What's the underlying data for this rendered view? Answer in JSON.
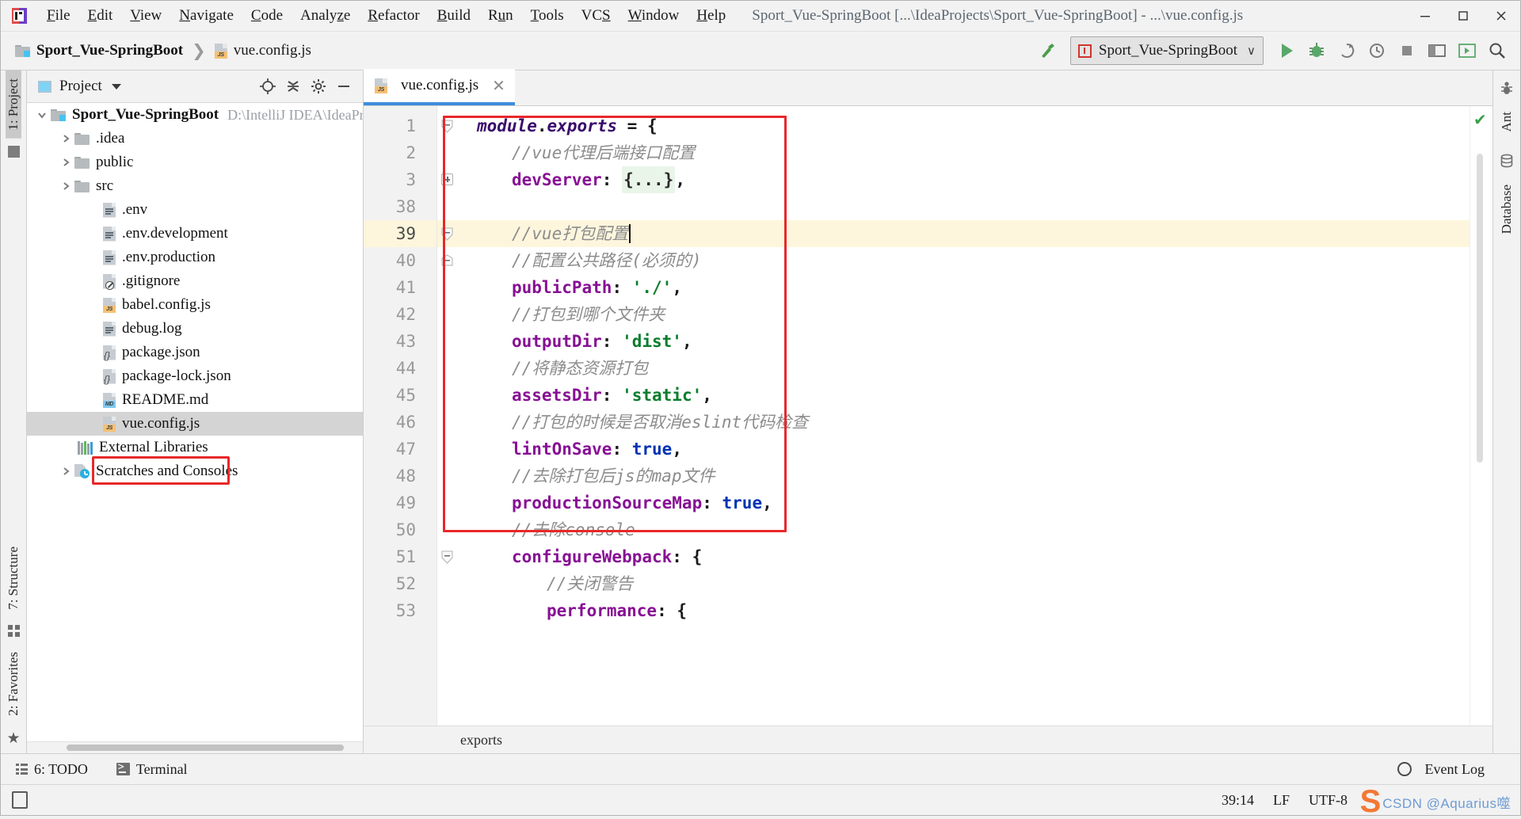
{
  "window": {
    "title": "Sport_Vue-SpringBoot [...\\IdeaProjects\\Sport_Vue-SpringBoot] - ...\\vue.config.js",
    "minimize": "—",
    "maximize": "□",
    "close": "✕"
  },
  "menubar": [
    {
      "label": "File",
      "mnemonic": "F"
    },
    {
      "label": "Edit",
      "mnemonic": "E"
    },
    {
      "label": "View",
      "mnemonic": "V"
    },
    {
      "label": "Navigate",
      "mnemonic": "N"
    },
    {
      "label": "Code",
      "mnemonic": "C"
    },
    {
      "label": "Analyze",
      "mnemonic": "z"
    },
    {
      "label": "Refactor",
      "mnemonic": "R"
    },
    {
      "label": "Build",
      "mnemonic": "B"
    },
    {
      "label": "Run",
      "mnemonic": "u"
    },
    {
      "label": "Tools",
      "mnemonic": "T"
    },
    {
      "label": "VCS",
      "mnemonic": "S"
    },
    {
      "label": "Window",
      "mnemonic": "W"
    },
    {
      "label": "Help",
      "mnemonic": "H"
    }
  ],
  "toolbar": {
    "breadcrumb_project": "Sport_Vue-SpringBoot",
    "breadcrumb_sep": "❯",
    "breadcrumb_file": "vue.config.js",
    "run_config": "Sport_Vue-SpringBoot",
    "run_config_chevron": "∨"
  },
  "project_panel": {
    "title": "Project",
    "tree": [
      {
        "label": "Sport_Vue-SpringBoot",
        "path": "D:\\IntelliJ IDEA\\IdeaProj",
        "icon": "folder-module-icon",
        "arrow": "down",
        "depth": 0,
        "bold": true
      },
      {
        "label": ".idea",
        "icon": "folder-icon",
        "arrow": "right",
        "depth": 1
      },
      {
        "label": "public",
        "icon": "folder-icon",
        "arrow": "right",
        "depth": 1
      },
      {
        "label": "src",
        "icon": "folder-icon",
        "arrow": "right",
        "depth": 1
      },
      {
        "label": ".env",
        "icon": "file-text-icon",
        "depth": 2
      },
      {
        "label": ".env.development",
        "icon": "file-text-icon",
        "depth": 2
      },
      {
        "label": ".env.production",
        "icon": "file-text-icon",
        "depth": 2
      },
      {
        "label": ".gitignore",
        "icon": "file-ignored-icon",
        "depth": 2
      },
      {
        "label": "babel.config.js",
        "icon": "file-js-icon",
        "depth": 2
      },
      {
        "label": "debug.log",
        "icon": "file-text-icon",
        "depth": 2
      },
      {
        "label": "package.json",
        "icon": "file-json-icon",
        "depth": 2
      },
      {
        "label": "package-lock.json",
        "icon": "file-json-icon",
        "depth": 2
      },
      {
        "label": "README.md",
        "icon": "file-md-icon",
        "depth": 2
      },
      {
        "label": "vue.config.js",
        "icon": "file-js-icon",
        "depth": 2,
        "selected": true,
        "highlighted": true
      },
      {
        "label": "External Libraries",
        "icon": "external-libraries-icon",
        "depth": 1
      },
      {
        "label": "Scratches and Consoles",
        "icon": "scratches-icon",
        "arrow": "right",
        "depth": 1
      }
    ]
  },
  "left_tool_strip": [
    {
      "label": "1: Project",
      "mnemonic": "1",
      "active": true
    }
  ],
  "left_tool_strip_bottom": [
    {
      "label": "7: Structure",
      "mnemonic": "7"
    },
    {
      "label": "2: Favorites",
      "mnemonic": "2"
    }
  ],
  "right_tool_strip": [
    {
      "label": "Ant"
    },
    {
      "label": "Database"
    }
  ],
  "editor": {
    "tab": {
      "label": "vue.config.js",
      "close": "✕"
    },
    "breadcrumb": "exports",
    "lines": [
      {
        "num": "1",
        "fold": "arrow-down",
        "tokens": [
          {
            "t": "module",
            "c": "ital"
          },
          {
            "t": ".",
            "c": "punc"
          },
          {
            "t": "exports",
            "c": "ital"
          },
          {
            "t": " = ",
            "c": "punc"
          },
          {
            "t": "{",
            "c": "punc"
          }
        ],
        "indent": 0
      },
      {
        "num": "2",
        "tokens": [
          {
            "t": "//vue代理后端接口配置",
            "c": "cmt"
          }
        ],
        "indent": 1
      },
      {
        "num": "3",
        "fold": "plus",
        "tokens": [
          {
            "t": "devServer",
            "c": "prop"
          },
          {
            "t": ": ",
            "c": "punc"
          },
          {
            "t": "{...}",
            "c": "fold-ph"
          },
          {
            "t": ",",
            "c": "punc"
          }
        ],
        "indent": 1
      },
      {
        "num": "38",
        "tokens": [],
        "indent": 0
      },
      {
        "num": "39",
        "fold": "arrow-down",
        "current": true,
        "tokens": [
          {
            "t": "//vue打包配置",
            "c": "cmt"
          }
        ],
        "indent": 1,
        "caret": true
      },
      {
        "num": "40",
        "fold": "minus-end",
        "tokens": [
          {
            "t": "//配置公共路径(必须的)",
            "c": "cmt"
          }
        ],
        "indent": 1
      },
      {
        "num": "41",
        "tokens": [
          {
            "t": "publicPath",
            "c": "prop"
          },
          {
            "t": ": ",
            "c": "punc"
          },
          {
            "t": "'./'",
            "c": "str"
          },
          {
            "t": ",",
            "c": "punc"
          }
        ],
        "indent": 1
      },
      {
        "num": "42",
        "tokens": [
          {
            "t": "//打包到哪个文件夹",
            "c": "cmt"
          }
        ],
        "indent": 1
      },
      {
        "num": "43",
        "tokens": [
          {
            "t": "outputDir",
            "c": "prop"
          },
          {
            "t": ": ",
            "c": "punc"
          },
          {
            "t": "'dist'",
            "c": "str"
          },
          {
            "t": ",",
            "c": "punc"
          }
        ],
        "indent": 1
      },
      {
        "num": "44",
        "tokens": [
          {
            "t": "//将静态资源打包",
            "c": "cmt"
          }
        ],
        "indent": 1
      },
      {
        "num": "45",
        "tokens": [
          {
            "t": "assetsDir",
            "c": "prop"
          },
          {
            "t": ": ",
            "c": "punc"
          },
          {
            "t": "'static'",
            "c": "str"
          },
          {
            "t": ",",
            "c": "punc"
          }
        ],
        "indent": 1
      },
      {
        "num": "46",
        "tokens": [
          {
            "t": "//打包的时候是否取消eslint代码检查",
            "c": "cmt"
          }
        ],
        "indent": 1
      },
      {
        "num": "47",
        "tokens": [
          {
            "t": "lintOnSave",
            "c": "prop"
          },
          {
            "t": ": ",
            "c": "punc"
          },
          {
            "t": "true",
            "c": "bool"
          },
          {
            "t": ",",
            "c": "punc"
          }
        ],
        "indent": 1
      },
      {
        "num": "48",
        "tokens": [
          {
            "t": "//去除打包后js的map文件",
            "c": "cmt"
          }
        ],
        "indent": 1
      },
      {
        "num": "49",
        "tokens": [
          {
            "t": "productionSourceMap",
            "c": "prop"
          },
          {
            "t": ": ",
            "c": "punc"
          },
          {
            "t": "true",
            "c": "bool"
          },
          {
            "t": ",",
            "c": "punc"
          }
        ],
        "indent": 1
      },
      {
        "num": "50",
        "tokens": [
          {
            "t": "//去除console",
            "c": "cmt"
          }
        ],
        "indent": 1
      },
      {
        "num": "51",
        "fold": "minus",
        "tokens": [
          {
            "t": "configureWebpack",
            "c": "prop"
          },
          {
            "t": ": ",
            "c": "punc"
          },
          {
            "t": "{",
            "c": "punc"
          }
        ],
        "indent": 1
      },
      {
        "num": "52",
        "tokens": [
          {
            "t": "//关闭警告",
            "c": "cmt"
          }
        ],
        "indent": 2
      },
      {
        "num": "53",
        "tokens": [
          {
            "t": "performance",
            "c": "prop"
          },
          {
            "t": ": ",
            "c": "punc"
          },
          {
            "t": "{",
            "c": "punc"
          }
        ],
        "indent": 2
      }
    ]
  },
  "bottom_bar": {
    "todo": {
      "label": "6: TODO",
      "mnemonic": "6"
    },
    "terminal": {
      "label": "Terminal"
    },
    "event_log": {
      "label": "Event Log"
    }
  },
  "status_bar": {
    "caret_position": "39:14",
    "line_separator": "LF",
    "encoding": "UTF-8",
    "watermark_s": "S",
    "watermark_text": "CSDN @Aquarius噬"
  },
  "colors": {
    "accent_blue": "#3e8ddd",
    "red_annotation": "#e8282a",
    "highlight_line": "#fdf6dd",
    "selection_gray": "#d4d4d4",
    "js_badge": "#f5c173",
    "md_badge": "#7fc9ef",
    "run_green": "#4a9e4a",
    "logo_orange": "#f4671c"
  }
}
